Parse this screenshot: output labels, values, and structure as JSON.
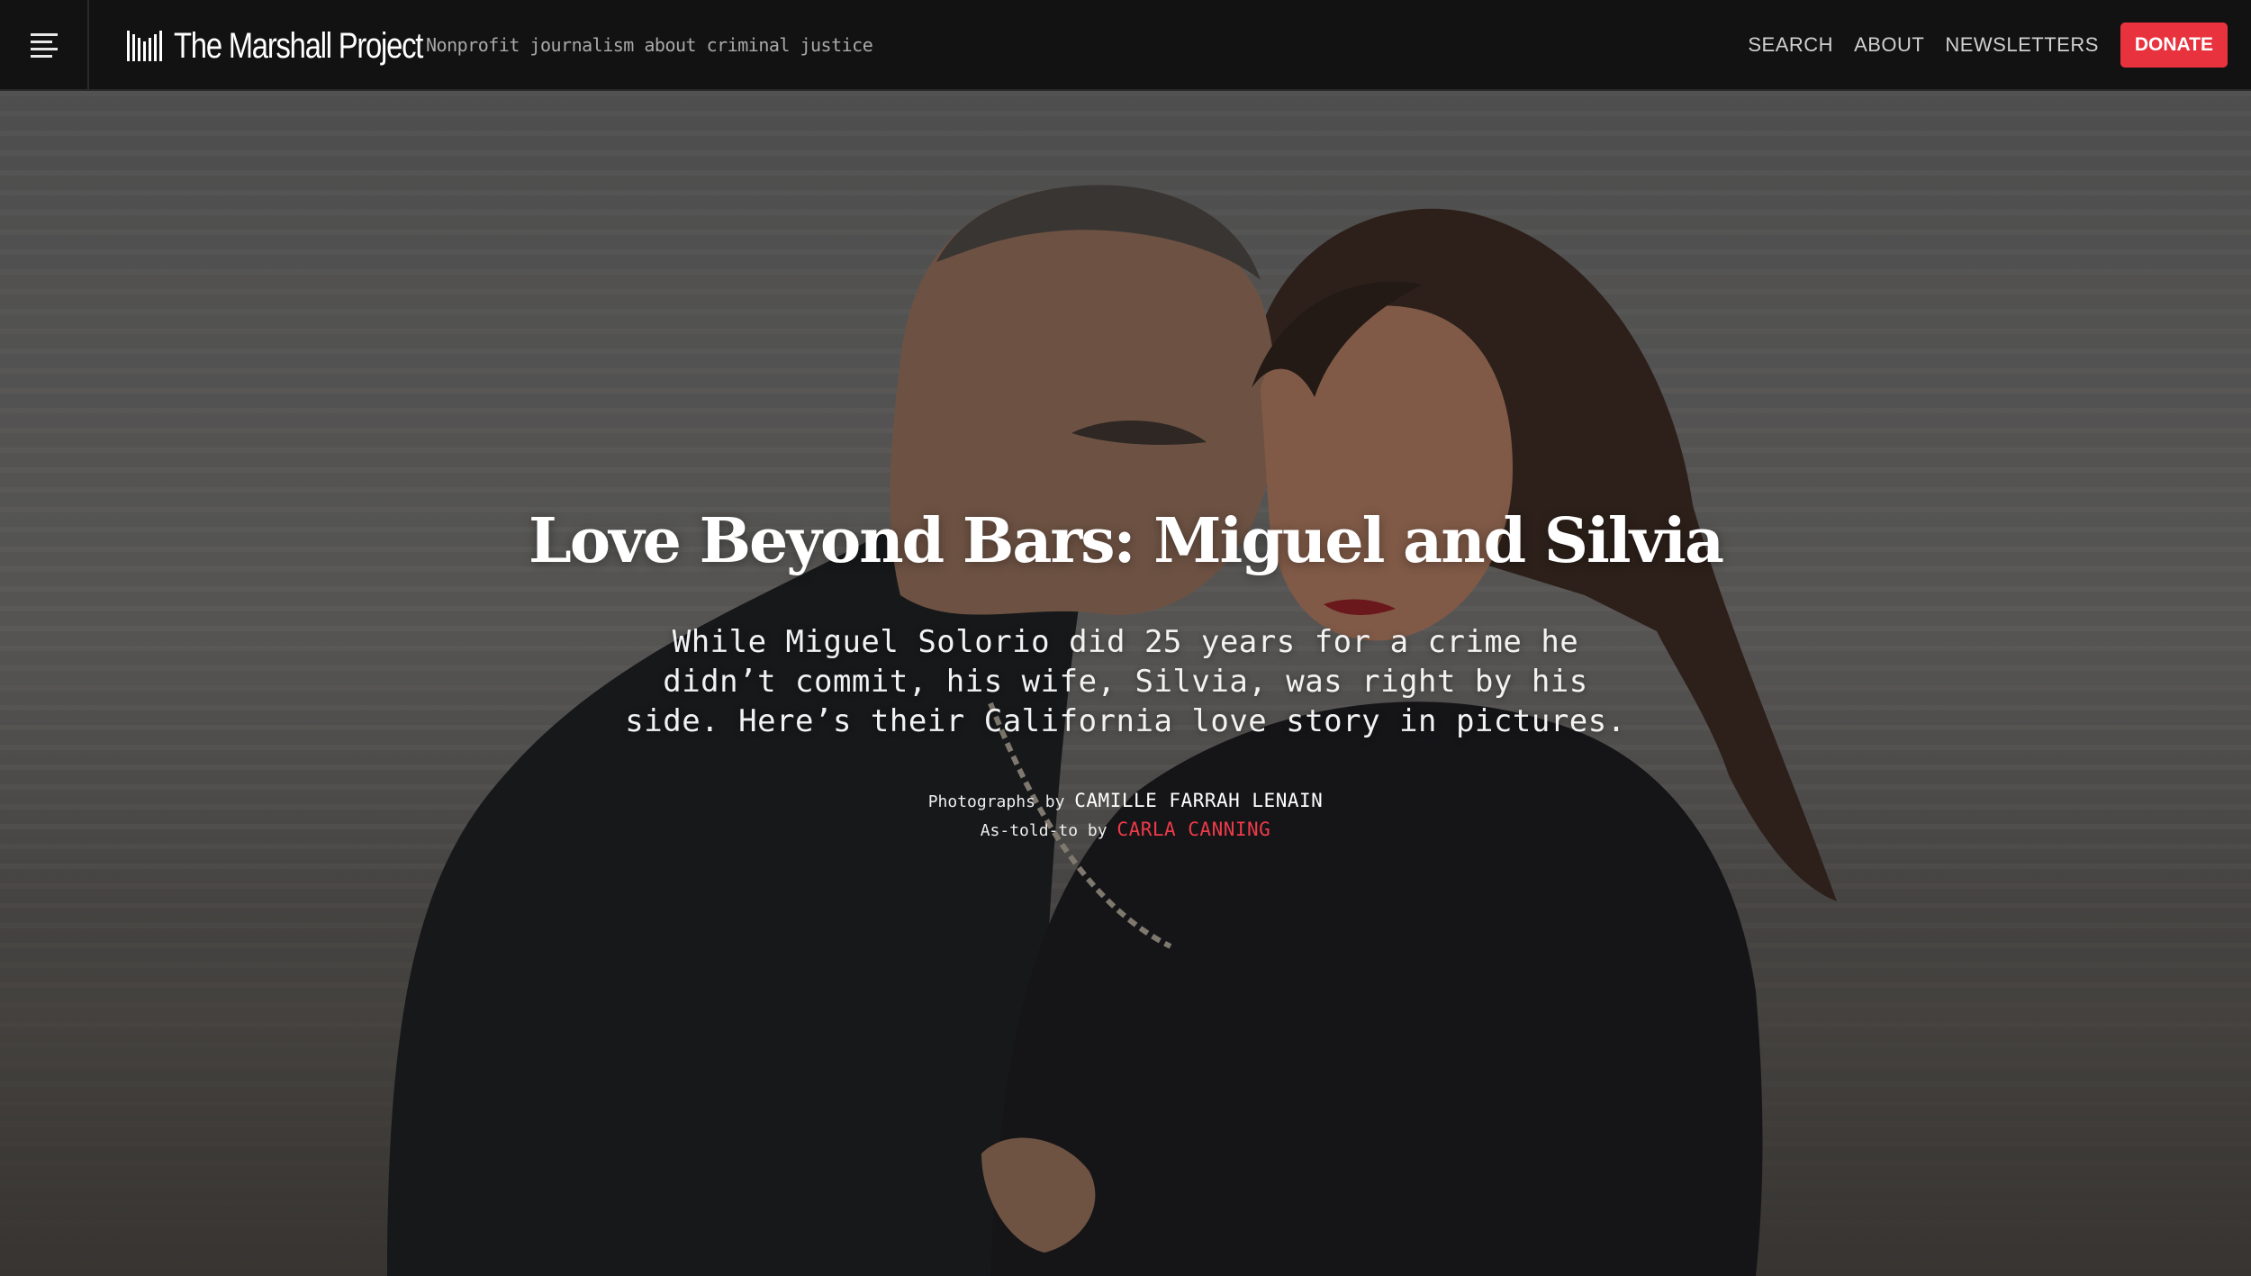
{
  "header": {
    "logo_text": "The Marshall Project",
    "tagline": "Nonprofit journalism about criminal justice",
    "nav": {
      "search": "SEARCH",
      "about": "ABOUT",
      "newsletters": "NEWSLETTERS",
      "donate": "DONATE"
    },
    "icons": {
      "menu": "hamburger-menu-icon",
      "logo_mark": "bars-logo-icon"
    }
  },
  "hero": {
    "headline": "Love Beyond Bars: Miguel and Silvia",
    "dek": "While Miguel Solorio did 25 years for a crime he didn’t commit, his wife, Silvia, was right by his side. Here’s their California love story in pictures.",
    "credits": {
      "photos_prefix": "Photographs by",
      "photographer": "CAMILLE FARRAH LENAIN",
      "told_prefix": "As-told-to by",
      "writer": "CARLA CANNING"
    }
  },
  "colors": {
    "accent": "#e8333f",
    "header_bg": "#121212",
    "link_red": "#ef3a48"
  }
}
